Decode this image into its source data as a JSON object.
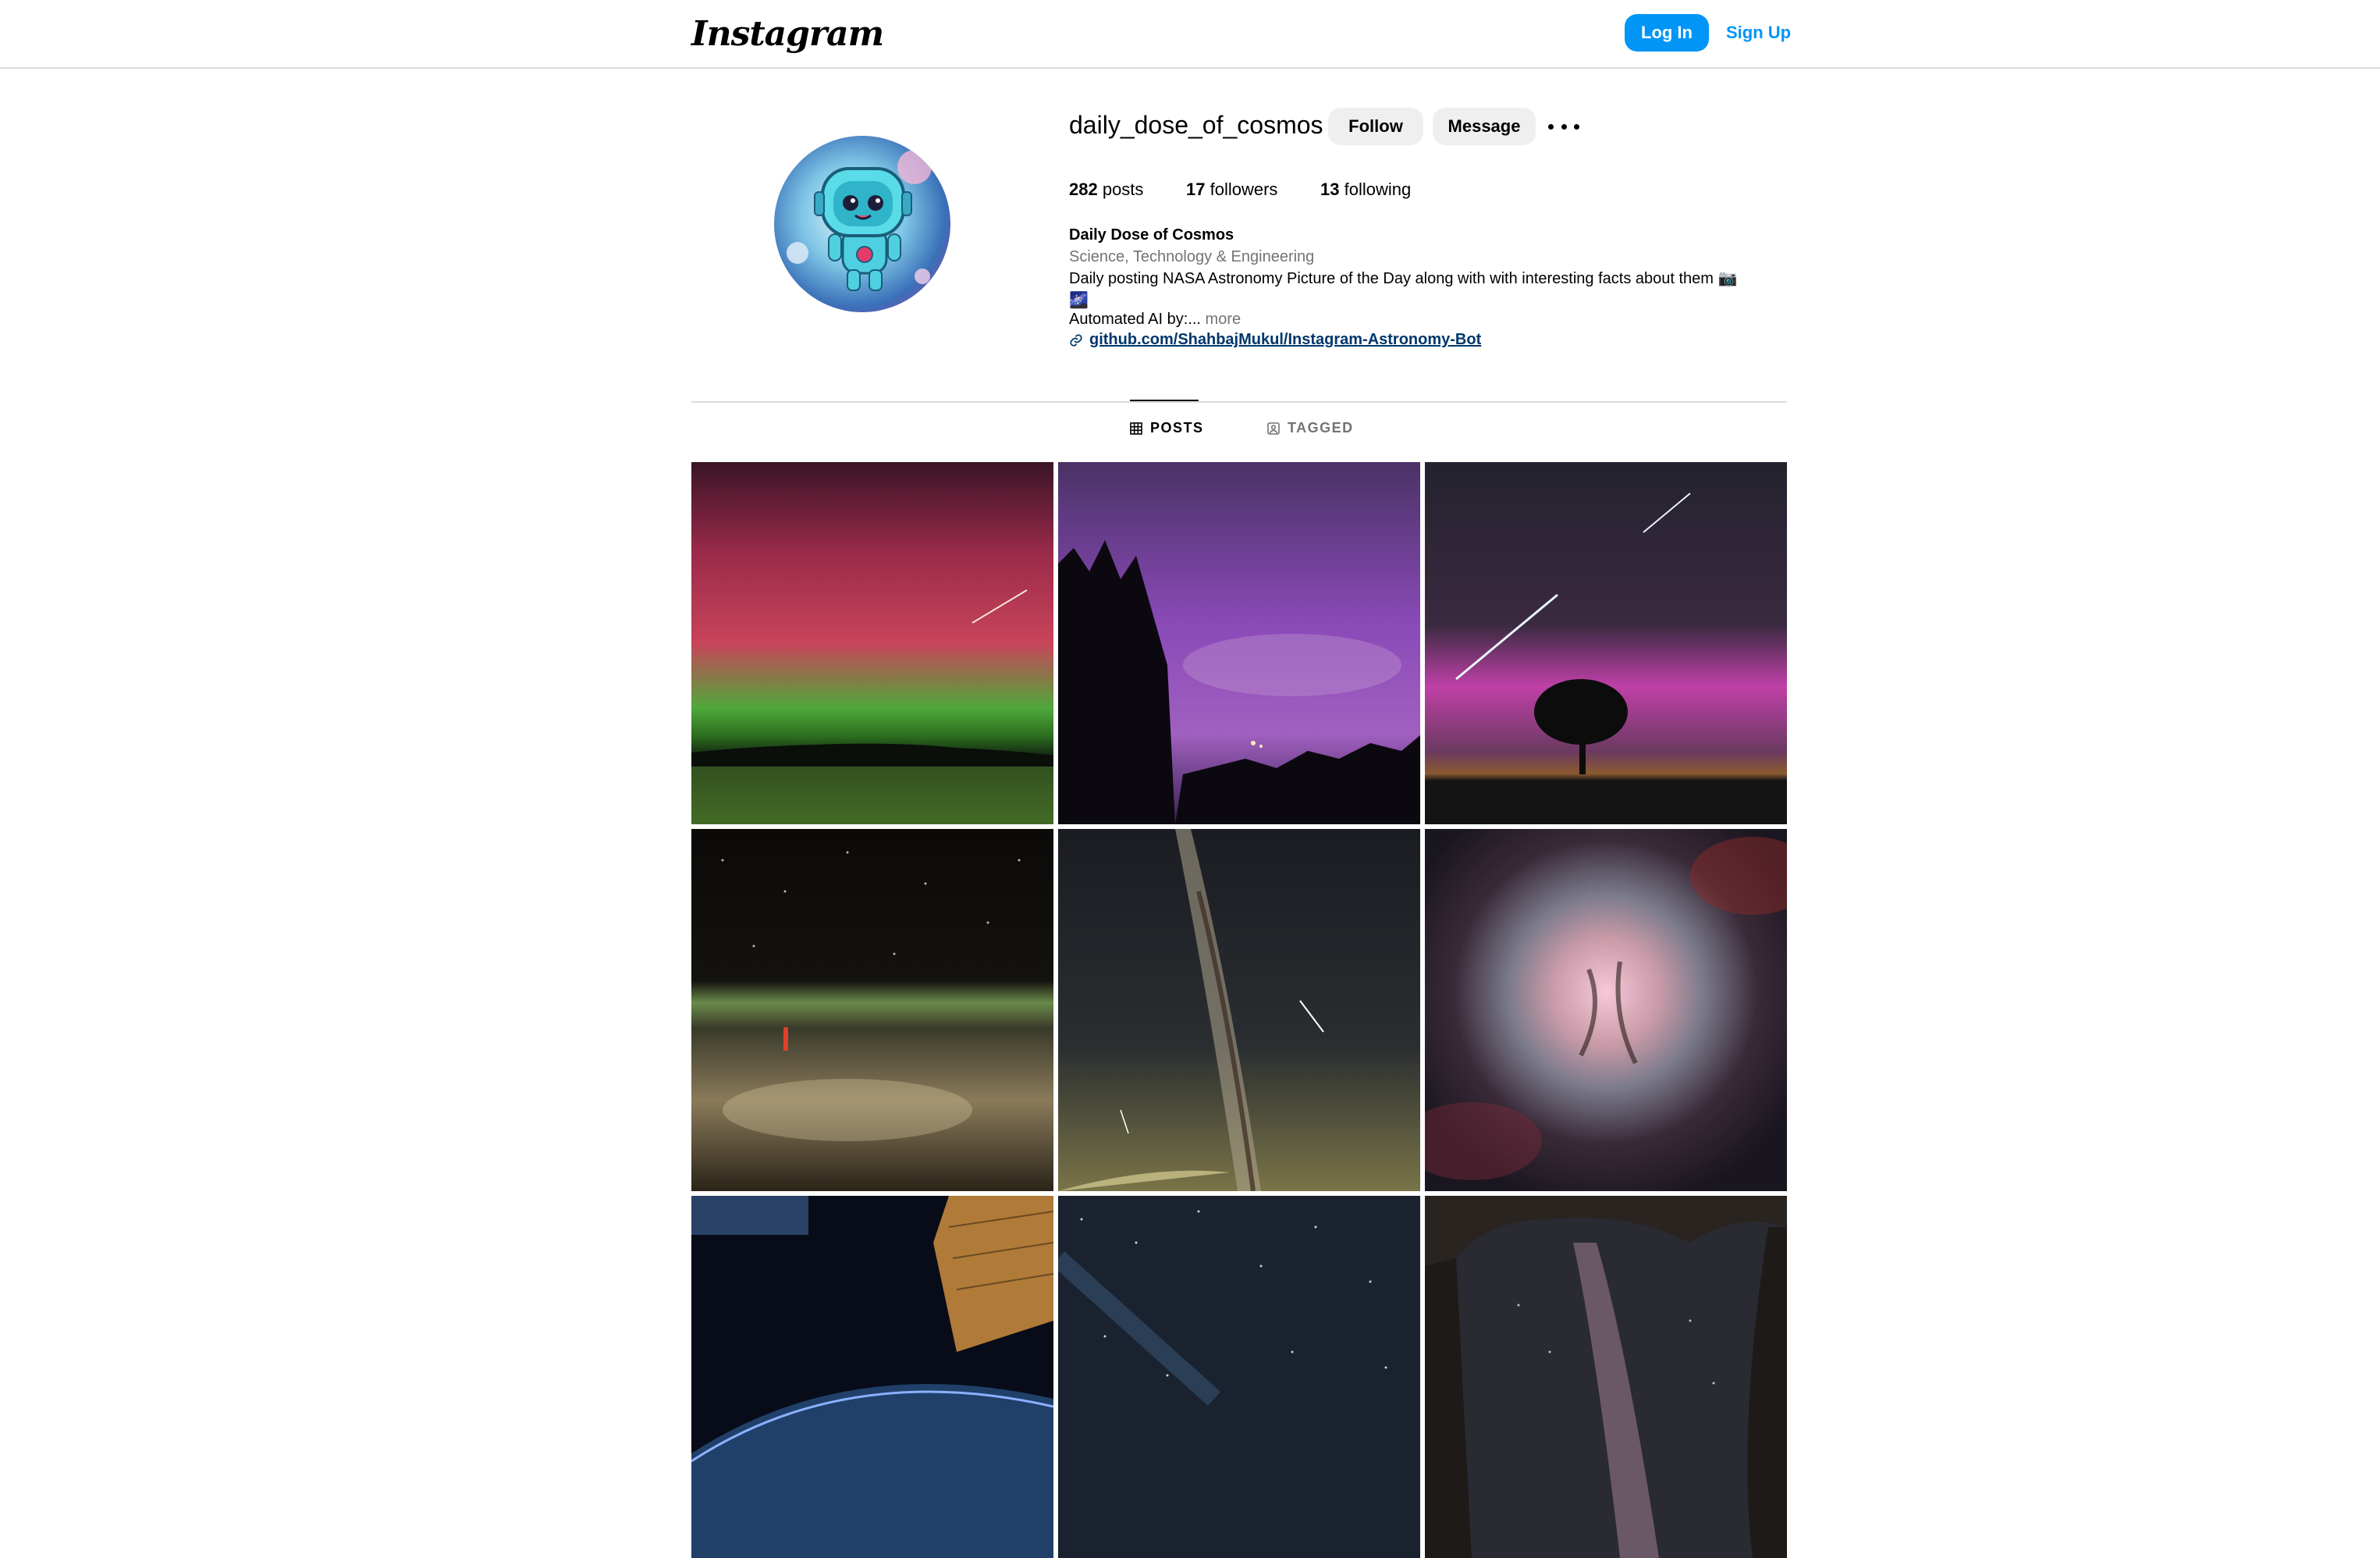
{
  "header": {
    "logo_text": "Instagram",
    "login_label": "Log In",
    "signup_label": "Sign Up"
  },
  "profile": {
    "username": "daily_dose_of_cosmos",
    "follow_label": "Follow",
    "message_label": "Message",
    "more_icon": "more-horizontal-icon",
    "stats": {
      "posts_count": "282",
      "posts_label": " posts",
      "followers_count": "17",
      "followers_label": " followers",
      "following_count": "13",
      "following_label": " following"
    },
    "full_name": "Daily Dose of Cosmos",
    "category": "Science, Technology & Engineering",
    "bio_line1": "Daily posting NASA Astronomy Picture of the Day along with with interesting facts about them 📷",
    "bio_line2": "🌌",
    "bio_line3": "Automated AI by:...",
    "bio_more": " more",
    "link_text": "github.com/ShahbajMukul/Instagram-Astronomy-Bot",
    "link_icon": "link-icon"
  },
  "tabs": [
    {
      "label": "POSTS",
      "icon": "grid-icon",
      "active": true
    },
    {
      "label": "TAGGED",
      "icon": "tagged-icon",
      "active": false
    }
  ],
  "posts": [
    {
      "name": "aurora-lake"
    },
    {
      "name": "purple-sky-trees"
    },
    {
      "name": "meteor-tree-aurora"
    },
    {
      "name": "earth-from-orbit"
    },
    {
      "name": "milky-way-meteors"
    },
    {
      "name": "nebula"
    },
    {
      "name": "iss-solar-panel"
    },
    {
      "name": "starfield"
    },
    {
      "name": "cave-milky-way"
    }
  ],
  "colors": {
    "accent": "#0095f6",
    "link": "#00376b",
    "muted": "#737373",
    "divider": "#dbdbdb",
    "button_bg": "#efefef"
  }
}
